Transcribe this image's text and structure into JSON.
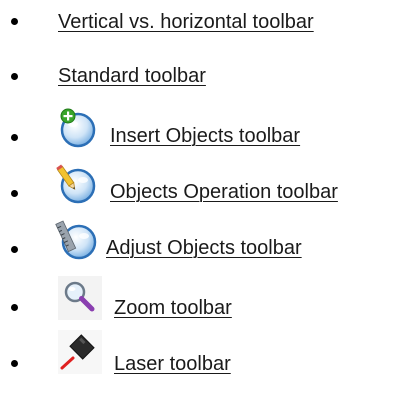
{
  "links": [
    {
      "label": "Vertical vs. horizontal toolbar",
      "icon": null
    },
    {
      "label": "Standard toolbar",
      "icon": null
    },
    {
      "label": "Insert Objects toolbar",
      "icon": "insert-objects-globe-plus-icon"
    },
    {
      "label": "Objects Operation toolbar",
      "icon": "objects-operation-globe-pencil-icon"
    },
    {
      "label": "Adjust Objects toolbar",
      "icon": "adjust-objects-globe-ruler-icon"
    },
    {
      "label": "Zoom toolbar",
      "icon": "magnifier-icon"
    },
    {
      "label": "Laser toolbar",
      "icon": "laser-pointer-icon"
    }
  ],
  "colors": {
    "link_text": "#1a1a1a",
    "bullet": "#000000",
    "globe_fill": "#cfe4f7",
    "globe_stroke": "#2c6fb6",
    "plus_green": "#3aa52b"
  }
}
